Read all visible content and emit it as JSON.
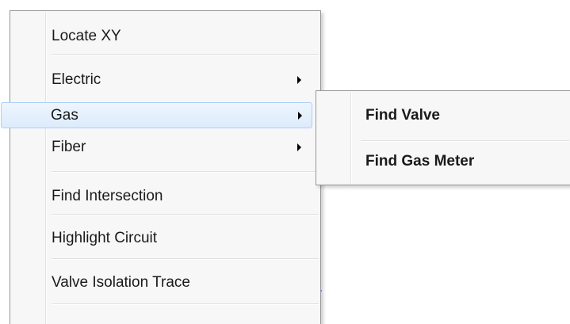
{
  "menu": {
    "items": [
      {
        "label": "Locate XY",
        "has_submenu": false
      },
      {
        "label": "Electric",
        "has_submenu": true
      },
      {
        "label": "Gas",
        "has_submenu": true,
        "selected": true
      },
      {
        "label": "Fiber",
        "has_submenu": true
      },
      {
        "label": "Find Intersection",
        "has_submenu": false
      },
      {
        "label": "Highlight Circuit",
        "has_submenu": false
      },
      {
        "label": "Valve Isolation Trace",
        "has_submenu": false
      }
    ]
  },
  "submenu": {
    "parent": "Gas",
    "items": [
      {
        "label": "Find Valve"
      },
      {
        "label": "Find Gas Meter"
      }
    ]
  },
  "icons": {
    "submenu_arrow": "chevron-right-icon"
  },
  "colors": {
    "menu_background": "#f7f7f7",
    "menu_border": "#979797",
    "selection_fill": "#dcebfc",
    "selection_border": "#aecff7",
    "text": "#1a1a1a"
  }
}
